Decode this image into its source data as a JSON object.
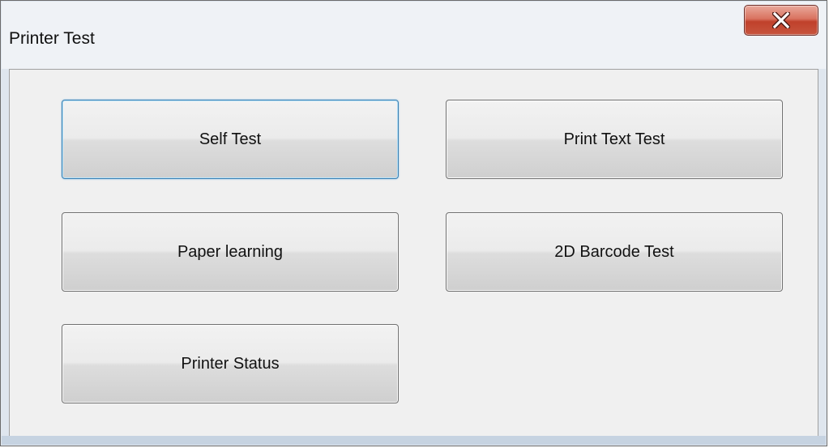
{
  "window": {
    "title": "Printer Test",
    "close_icon": "close-icon"
  },
  "buttons": {
    "self_test": "Self Test",
    "print_text_test": "Print Text Test",
    "paper_learning": "Paper learning",
    "barcode_2d_test": "2D Barcode Test",
    "printer_status": "Printer Status"
  },
  "colors": {
    "close_button": "#c7553e",
    "focus_border": "#3c7fb1",
    "client_background": "#f0f0f0"
  }
}
